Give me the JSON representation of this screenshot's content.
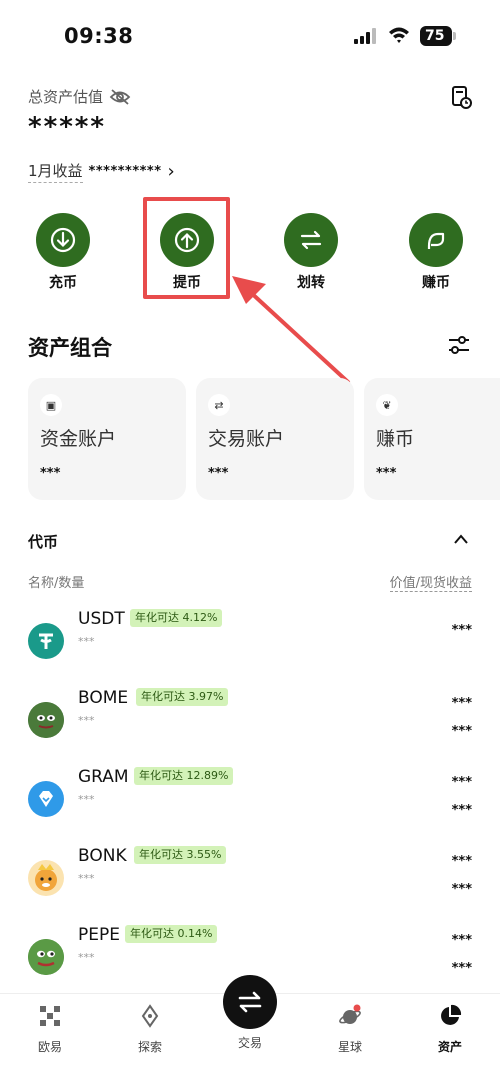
{
  "status_bar": {
    "time": "09:38",
    "battery": "75"
  },
  "header": {
    "total_label": "总资产估值",
    "total_value": "*****",
    "income_label": "1月收益",
    "income_value": "**********",
    "icons": [
      "eye-off-icon",
      "history-icon"
    ]
  },
  "actions": [
    {
      "label": "充币",
      "icon": "deposit-icon"
    },
    {
      "label": "提币",
      "icon": "withdraw-icon"
    },
    {
      "label": "划转",
      "icon": "transfer-icon"
    },
    {
      "label": "赚币",
      "icon": "earn-icon"
    }
  ],
  "portfolio": {
    "title": "资产组合",
    "cards": [
      {
        "name": "资金账户",
        "value": "***"
      },
      {
        "name": "交易账户",
        "value": "***"
      },
      {
        "name": "赚币",
        "value": "***"
      }
    ]
  },
  "tokens": {
    "title": "代币",
    "col_left": "名称/数量",
    "col_right": "价值/现货收益",
    "items": [
      {
        "symbol": "USDT",
        "badge": "年化可达 4.12%",
        "qty": "***",
        "value": "***",
        "pnl": ""
      },
      {
        "symbol": "BOME",
        "badge": "年化可达 3.97%",
        "qty": "***",
        "value": "***",
        "pnl": "***"
      },
      {
        "symbol": "GRAM",
        "badge": "年化可达 12.89%",
        "qty": "***",
        "value": "***",
        "pnl": "***"
      },
      {
        "symbol": "BONK",
        "badge": "年化可达 3.55%",
        "qty": "***",
        "value": "***",
        "pnl": "***"
      },
      {
        "symbol": "PEPE",
        "badge": "年化可达 0.14%",
        "qty": "***",
        "value": "***",
        "pnl": "***"
      }
    ]
  },
  "nav": {
    "items": [
      {
        "label": "欧易",
        "icon": "okx-logo-icon"
      },
      {
        "label": "探索",
        "icon": "compass-icon"
      },
      {
        "label": "交易",
        "icon": "swap-icon"
      },
      {
        "label": "星球",
        "icon": "planet-icon"
      },
      {
        "label": "资产",
        "icon": "pie-chart-icon"
      }
    ],
    "active": "资产"
  },
  "colors": {
    "brand_green": "#2f6c20",
    "badge_bg": "#d3f2b8",
    "highlight_red": "#e84c4c"
  }
}
